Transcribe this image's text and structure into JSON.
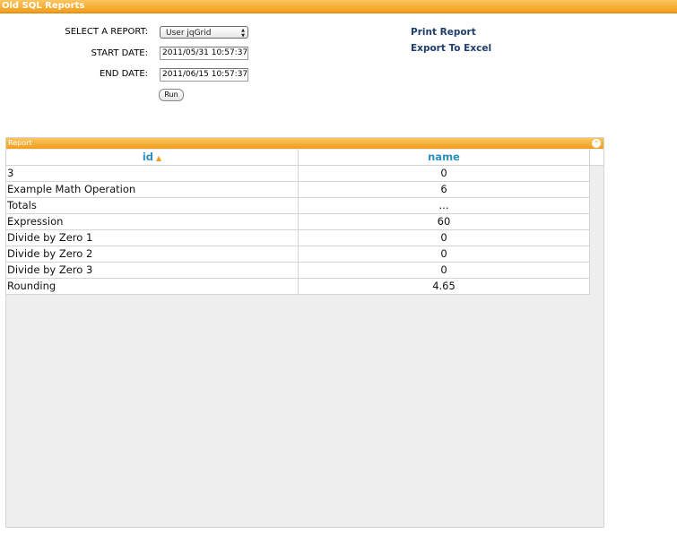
{
  "window": {
    "title": "Old SQL Reports"
  },
  "form": {
    "select_report_label": "SELECT A REPORT:",
    "select_report_value": "User jqGrid",
    "start_date_label": "START DATE:",
    "start_date_value": "2011/05/31 10:57:37",
    "end_date_label": "END DATE:",
    "end_date_value": "2011/06/15 10:57:37",
    "run_label": "Run"
  },
  "actions": {
    "print_label": "Print Report",
    "export_label": "Export To Excel"
  },
  "grid": {
    "caption": "Report",
    "collapse_glyph": "⌃",
    "columns": [
      "id",
      "name"
    ],
    "sort_glyph": "▲",
    "rows": [
      [
        "3",
        "0"
      ],
      [
        "Example Math Operation",
        "6"
      ],
      [
        "Totals",
        "..."
      ],
      [
        "Expression",
        "60"
      ],
      [
        "Divide by Zero 1",
        "0"
      ],
      [
        "Divide by Zero 2",
        "0"
      ],
      [
        "Divide by Zero 3",
        "0"
      ],
      [
        "Rounding",
        "4.65"
      ]
    ]
  },
  "colors": {
    "accent": "#f29d1a",
    "header_text": "#2b8fc1",
    "link": "#1e3e6e"
  }
}
